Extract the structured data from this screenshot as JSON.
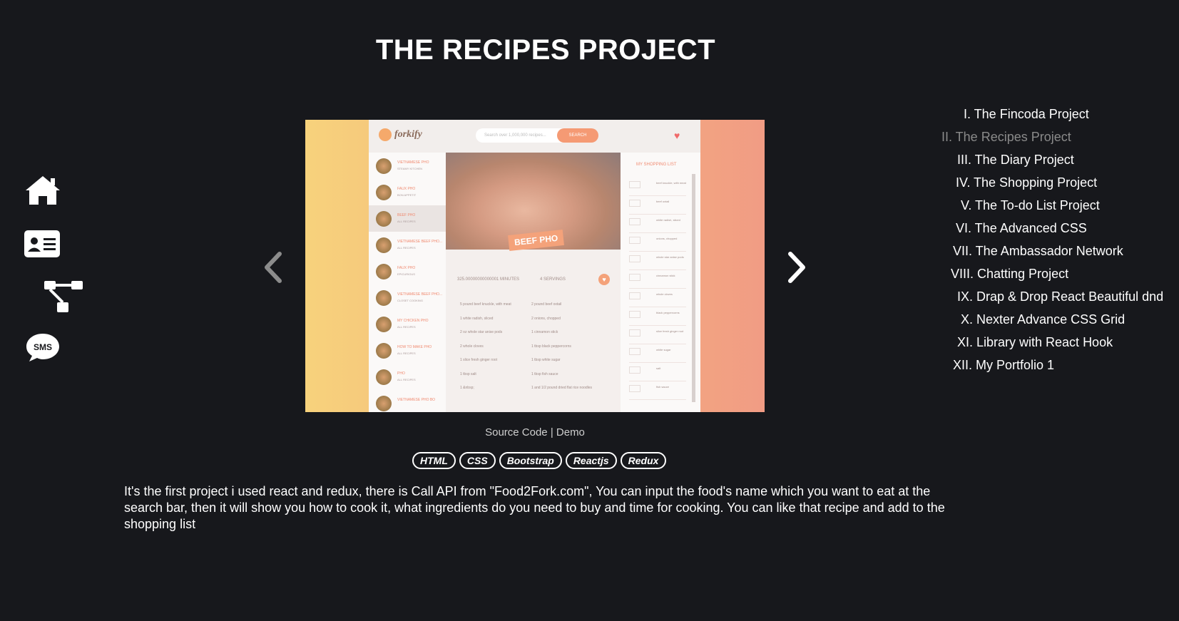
{
  "page": {
    "title": "THE RECIPES PROJECT"
  },
  "side_nav": [
    {
      "icon": "home-icon"
    },
    {
      "icon": "id-card-icon"
    },
    {
      "icon": "sitemap-icon"
    },
    {
      "icon": "sms-icon",
      "label": "SMS"
    }
  ],
  "slide": {
    "app_logo": "forkify",
    "search_placeholder": "Search over 1,000,000 recipes...",
    "search_button": "SEARCH",
    "recipe_tag": "BEEF PHO",
    "cook_time": "325.00000000000001 MINUTES",
    "servings": "4 SERVINGS",
    "shopping_title": "MY SHOPPING LIST",
    "results": [
      {
        "title": "VIETNAMESE PHO",
        "sub": "STEAMY KITCHEN"
      },
      {
        "title": "FAUX PHO",
        "sub": "BON APPETIT"
      },
      {
        "title": "BEEF PHO",
        "sub": "ALL RECIPES"
      },
      {
        "title": "VIETNAMESE BEEF PHO...",
        "sub": "ALL RECIPES"
      },
      {
        "title": "FAUX PHO",
        "sub": "EPICURIOUS"
      },
      {
        "title": "VIETNAMESE BEEF PHO...",
        "sub": "CLOSET COOKING"
      },
      {
        "title": "MY CHICKEN PHO",
        "sub": "ALL RECIPES"
      },
      {
        "title": "HOW TO MAKE PHO",
        "sub": "ALL RECIPES"
      },
      {
        "title": "PHO",
        "sub": "ALL RECIPES"
      },
      {
        "title": "VIETNAMESE PHO BO",
        "sub": ""
      }
    ],
    "ingredients": [
      "5 pound beef knuckle, with meat",
      "2 pound beef oxtail",
      "1 white radish, sliced",
      "2 onions, chopped",
      "2 oz whole star anise pods",
      "1 cinnamon stick",
      "2 whole cloves",
      "1 tbsp black peppercorns",
      "1 slice fresh ginger root",
      "1 tbsp white sugar",
      "1 tbsp salt",
      "1 tbsp fish sauce",
      "1 &nbsp;",
      "1 and 1/2 pound dried flat rice noodles"
    ],
    "shopping_items": [
      "beef knuckle, with meat",
      "beef oxtail",
      "white radish, sliced",
      "onions, chopped",
      "whole star anise pods",
      "cinnamon stick",
      "whole cloves",
      "black peppercorns",
      "slice fresh ginger root",
      "white sugar",
      "salt",
      "fish sauce"
    ]
  },
  "links": {
    "source": "Source Code",
    "separator": " | ",
    "demo": "Demo"
  },
  "tags": [
    "HTML",
    "CSS",
    "Bootstrap",
    "Reactjs",
    "Redux"
  ],
  "description": "It's the first project i used react and redux, there is Call API from \"Food2Fork.com\", You can input the food's name which you want to eat at the search bar, then it will show you how to cook it, what ingredients do you need to buy and time for cooking. You can like that recipe and add to the shopping list",
  "projects": [
    {
      "label": "I. The Fincoda Project",
      "current": false
    },
    {
      "label": "II. The Recipes Project",
      "current": true
    },
    {
      "label": "III. The Diary Project",
      "current": false
    },
    {
      "label": "IV. The Shopping Project",
      "current": false
    },
    {
      "label": "V. The To-do List Project",
      "current": false
    },
    {
      "label": "VI. The Advanced CSS",
      "current": false
    },
    {
      "label": "VII. The Ambassador Network",
      "current": false
    },
    {
      "label": "VIII. Chatting Project",
      "current": false
    },
    {
      "label": "IX. Drap & Drop React Beautiful dnd",
      "current": false
    },
    {
      "label": "X. Nexter Advance CSS Grid",
      "current": false
    },
    {
      "label": "XI. Library with React Hook",
      "current": false
    },
    {
      "label": "XII. My Portfolio 1",
      "current": false
    }
  ],
  "colors": {
    "background": "#17181c",
    "text": "#ffffff",
    "muted": "#8a8a8a",
    "accent": "#f59a74"
  }
}
